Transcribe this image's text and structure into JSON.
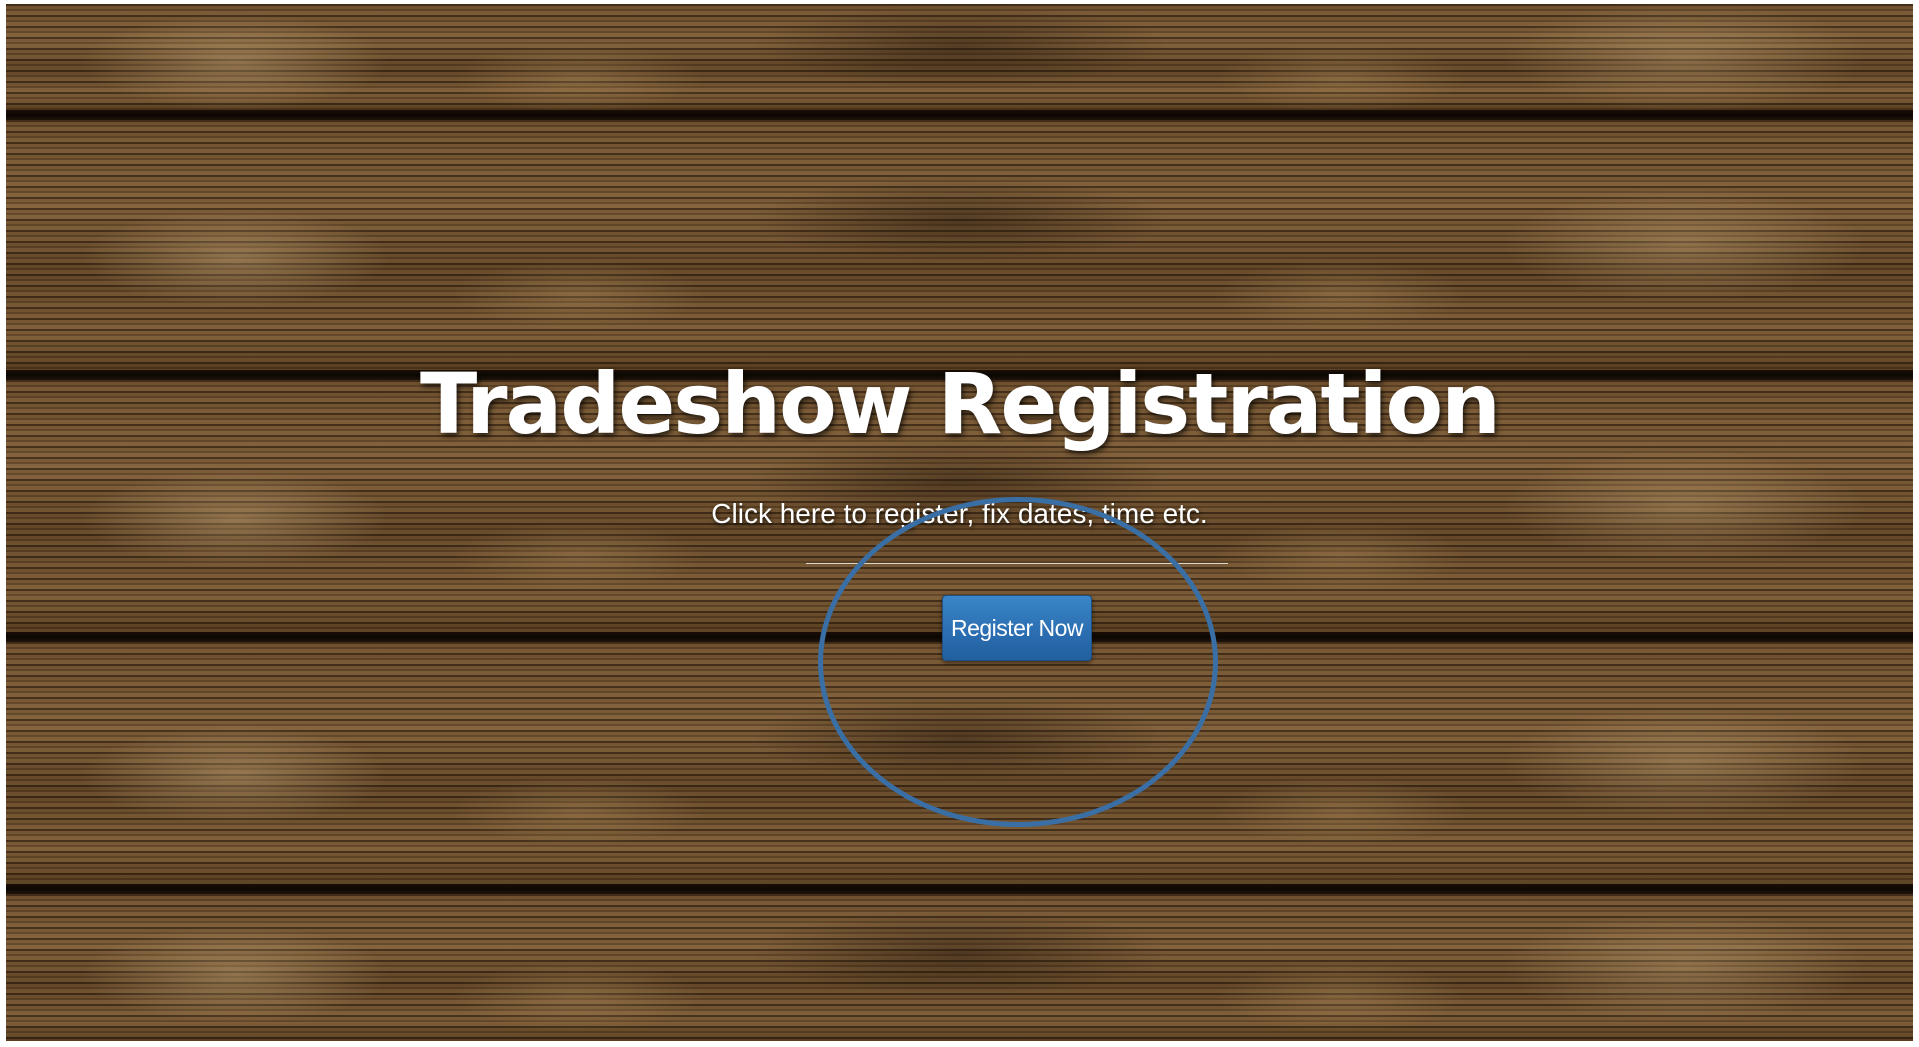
{
  "hero": {
    "title": "Tradeshow Registration",
    "subtitle": "Click here to register, fix dates, time etc.",
    "register_label": "Register Now"
  },
  "colors": {
    "button_blue": "#2a6db0",
    "highlight_circle": "#3a6fa6",
    "text": "#ffffff"
  },
  "background": {
    "texture": "wood-planks"
  },
  "annotation": {
    "shape": "circle",
    "target": "register-button"
  }
}
